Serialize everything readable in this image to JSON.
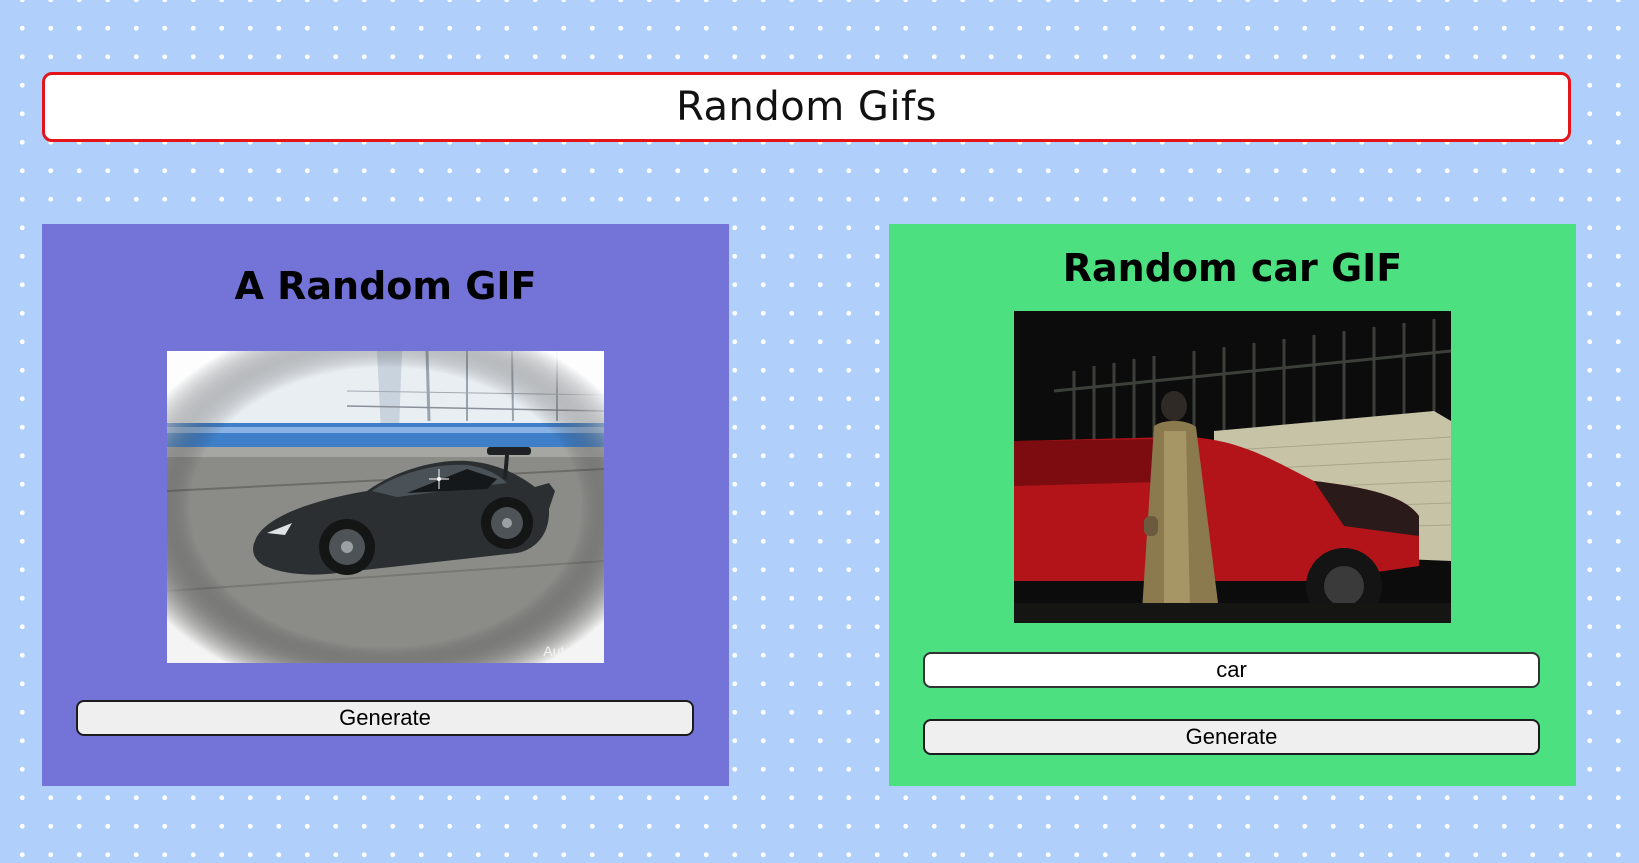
{
  "header": {
    "title": "Random Gifs"
  },
  "random_card": {
    "title": "A Random GIF",
    "image_alt": "",
    "watermark": "AutoGifs",
    "generate_label": "Generate",
    "background_color": "#7474d8"
  },
  "tag_card": {
    "title": "Random car GIF",
    "tag_input_value": "car",
    "generate_label": "Generate",
    "background_color": "#4ce080"
  },
  "colors": {
    "page_background": "#b0d0fb",
    "header_border": "#e3151a"
  }
}
